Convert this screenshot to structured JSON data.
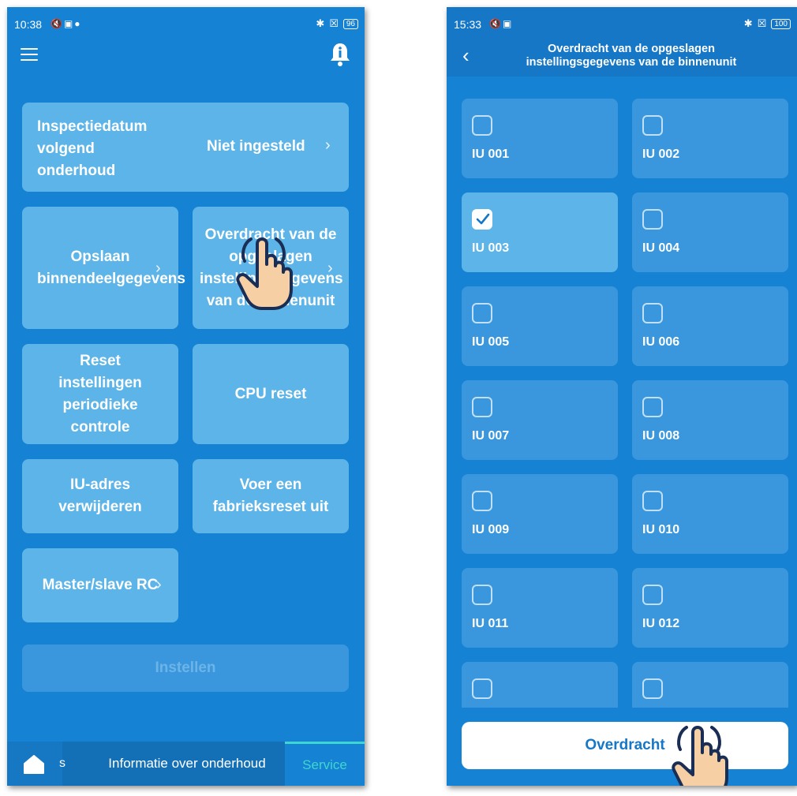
{
  "left_screen": {
    "status": {
      "time": "10:38",
      "battery": "96"
    },
    "cards": {
      "inspection_label": "Inspectiedatum volgend onderhoud",
      "inspection_value": "Niet ingesteld",
      "save_indoor": "Opslaan binnendeelgegevens",
      "transfer_stored": "Overdracht van de opgeslagen instellingsgegevens van de binnenunit",
      "reset_periodic": "Reset instellingen periodieke controle",
      "cpu_reset": "CPU reset",
      "delete_iu": "IU-adres verwijderen",
      "factory_reset": "Voer een fabrieksreset uit",
      "master_slave": "Master/slave RC"
    },
    "set_button": "Instellen",
    "bottom_nav": {
      "s": "s",
      "info": "Informatie over onderhoud",
      "service": "Service"
    }
  },
  "right_screen": {
    "status": {
      "time": "15:33",
      "battery": "100"
    },
    "header_title": "Overdracht van de opgeslagen instellingsgegevens van de binnenunit",
    "units": [
      {
        "label": "IU 001",
        "checked": false
      },
      {
        "label": "IU 002",
        "checked": false
      },
      {
        "label": "IU 003",
        "checked": true
      },
      {
        "label": "IU 004",
        "checked": false
      },
      {
        "label": "IU 005",
        "checked": false
      },
      {
        "label": "IU 006",
        "checked": false
      },
      {
        "label": "IU 007",
        "checked": false
      },
      {
        "label": "IU 008",
        "checked": false
      },
      {
        "label": "IU 009",
        "checked": false
      },
      {
        "label": "IU 010",
        "checked": false
      },
      {
        "label": "IU 011",
        "checked": false
      },
      {
        "label": "IU 012",
        "checked": false
      }
    ],
    "transfer_button": "Overdracht"
  },
  "colors": {
    "screen_bg": "#1582d3",
    "card_light": "#5db4e8",
    "card_dark": "#3a97dd",
    "active_tab": "#3fd6cf"
  }
}
